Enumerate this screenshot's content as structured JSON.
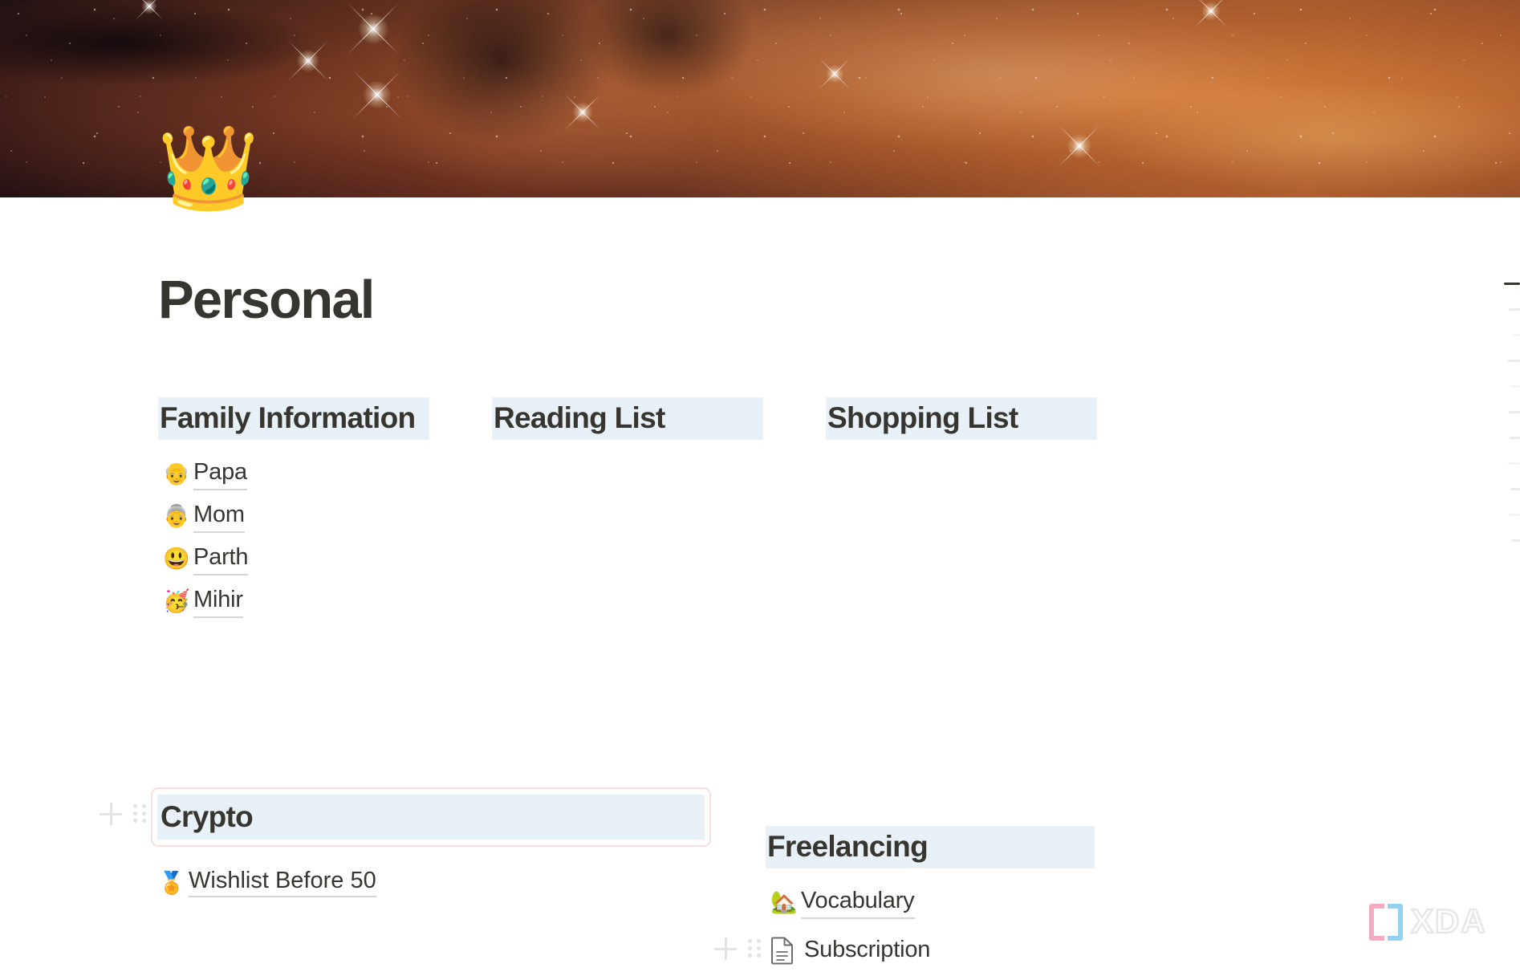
{
  "cover": {
    "alt_name": "nebula-cover-image",
    "dominant_colors": [
      "#0a0610",
      "#5c2a1e",
      "#b06534",
      "#c8793c"
    ]
  },
  "page": {
    "emoji": "👑",
    "emoji_name": "crown-emoji",
    "title": "Personal",
    "highlight_color": "#e8f1f7",
    "text_color": "#37352f",
    "selection_border_color": "#f7e0dd"
  },
  "columns": [
    {
      "header": "Family Information",
      "items": [
        {
          "emoji": "👴",
          "label": "Papa"
        },
        {
          "emoji": "👵",
          "label": "Mom"
        },
        {
          "emoji": "😃",
          "label": "Parth"
        },
        {
          "emoji": "🥳",
          "label": "Mihir"
        }
      ]
    },
    {
      "header": "Reading List",
      "items": []
    },
    {
      "header": "Shopping List",
      "items": []
    }
  ],
  "crypto_block": {
    "header": "Crypto",
    "selected": true,
    "items": [
      {
        "emoji": "🏅",
        "label": "Wishlist Before 50"
      }
    ]
  },
  "freelancing_block": {
    "header": "Freelancing",
    "items": [
      {
        "emoji": "🏡",
        "label": "Vocabulary",
        "icon": "house-with-garden-emoji"
      }
    ],
    "subscription": {
      "label": "Subscription",
      "icon": "page-document-icon"
    }
  },
  "gutter": {
    "add_label": "+",
    "add_icon": "plus-icon",
    "drag_icon": "drag-handle-icon"
  },
  "toc": {
    "ticks": [
      {
        "state": "active",
        "width": 20
      },
      {
        "state": "dim",
        "width": 14
      },
      {
        "state": "faint",
        "width": 10
      },
      {
        "state": "dim",
        "width": 16
      },
      {
        "state": "faint",
        "width": 11
      },
      {
        "state": "dim",
        "width": 14
      },
      {
        "state": "dim",
        "width": 13
      },
      {
        "state": "faint",
        "width": 15
      },
      {
        "state": "dim",
        "width": 12
      },
      {
        "state": "faint",
        "width": 14
      },
      {
        "state": "dim",
        "width": 11
      }
    ]
  },
  "watermark": {
    "text": "XDA",
    "bracket_left_color": "#f2a9bd",
    "bracket_right_color": "#8fd0ef"
  }
}
